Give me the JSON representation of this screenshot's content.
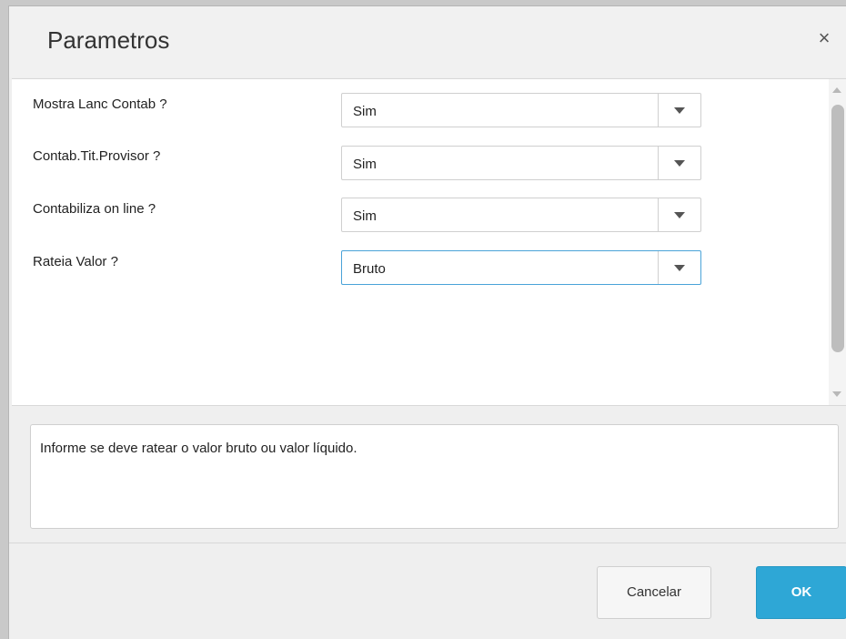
{
  "dialog": {
    "title": "Parametros",
    "close_glyph": "×"
  },
  "params": [
    {
      "label": "Mostra Lanc Contab ?",
      "value": "Sim"
    },
    {
      "label": "Contab.Tit.Provisor ?",
      "value": "Sim"
    },
    {
      "label": "Contabiliza on line ?",
      "value": "Sim"
    },
    {
      "label": "Rateia Valor ?",
      "value": "Bruto"
    }
  ],
  "help": {
    "text": "Informe se deve ratear o valor bruto ou valor líquido."
  },
  "buttons": {
    "cancel_label": "Cancelar",
    "ok_label": "OK"
  },
  "colors": {
    "ok_button": "#2ea7d6",
    "active_border": "#4aa3d8"
  }
}
